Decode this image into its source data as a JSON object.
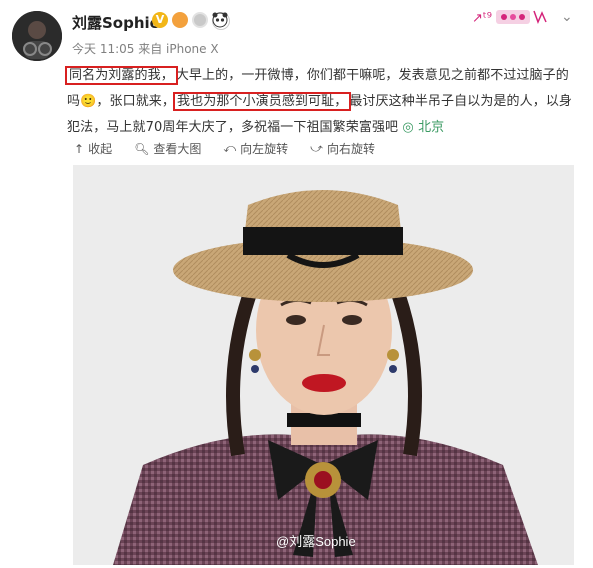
{
  "post": {
    "username": "刘露Sophie",
    "meta": "今天 11:05 来自 iPhone X",
    "segments": [
      {
        "text": "同名为刘露的我，",
        "boxed": true
      },
      {
        "text": "大早上的，一开微博，你们都干嘛呢，发表意见之前都不过过脑子的吗",
        "boxed": false
      },
      {
        "text": "🙂",
        "boxed": false
      },
      {
        "text": "，张口就来，",
        "boxed": false
      },
      {
        "text": "我也为那个小演员感到可耻，",
        "boxed": true
      },
      {
        "text": "最讨厌这种半吊子自以为是的人，以身犯法，马上就70周年大庆了，多祝福一下祖国繁荣富强吧",
        "boxed": false
      }
    ],
    "location": "北京",
    "toolbar": [
      {
        "icon": "collapse-icon",
        "label": "收起"
      },
      {
        "icon": "zoom-icon",
        "label": "查看大图"
      },
      {
        "icon": "rotate-left-icon",
        "label": "向左旋转"
      },
      {
        "icon": "rotate-right-icon",
        "label": "向右旋转"
      }
    ],
    "watermark": "@刘露Sophie"
  },
  "colors": {
    "highlight_box": "#d82020",
    "location": "#3a9a62"
  }
}
